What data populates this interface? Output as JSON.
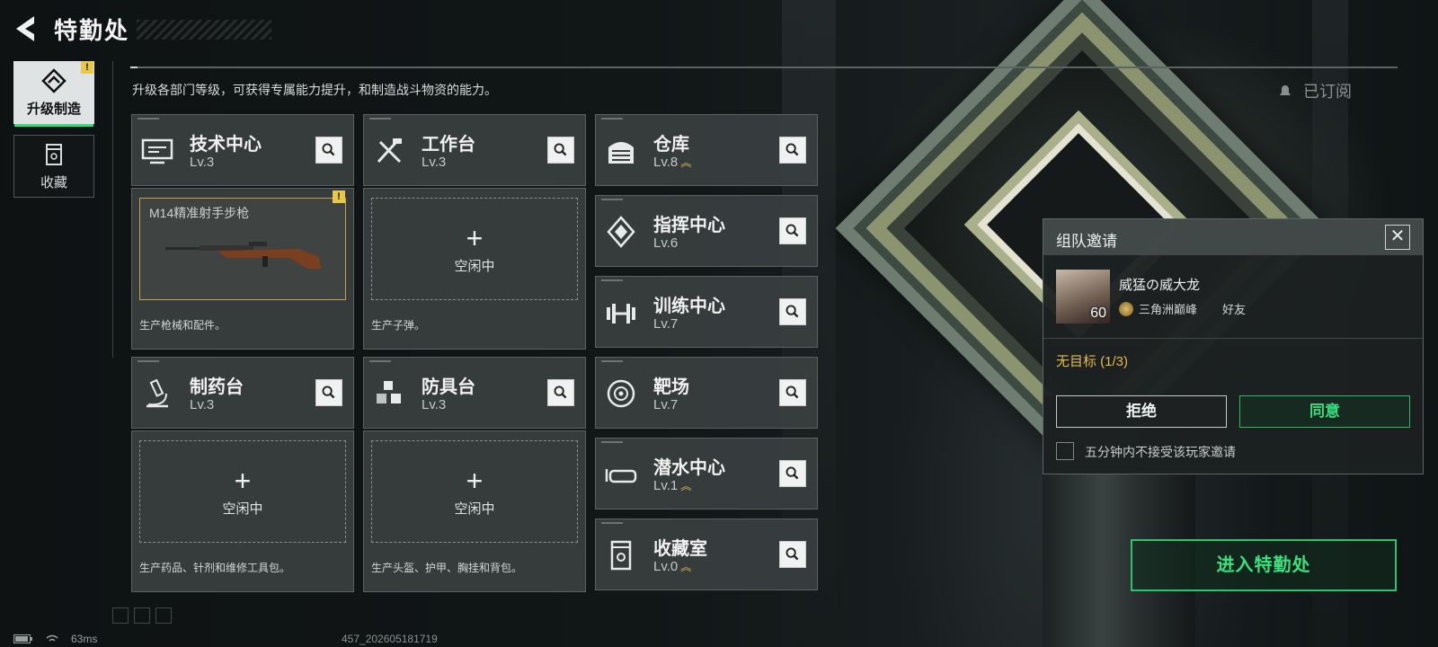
{
  "header": {
    "title": "特勤处",
    "subtitle": "升级各部门等级，可获得专属能力提升，和制造战斗物资的能力。"
  },
  "sidebar": {
    "tabs": [
      {
        "label": "升级制造",
        "icon": "upgrade-icon",
        "active": true,
        "alert": "!"
      },
      {
        "label": "收藏",
        "icon": "collection-icon",
        "active": false
      }
    ]
  },
  "departments": {
    "tech": {
      "name": "技术中心",
      "level": "Lv.3",
      "icon": "monitor-icon"
    },
    "workbench": {
      "name": "工作台",
      "level": "Lv.3",
      "icon": "tools-icon"
    },
    "warehouse": {
      "name": "仓库",
      "level": "Lv.8",
      "icon": "shutter-icon"
    },
    "command": {
      "name": "指挥中心",
      "level": "Lv.6",
      "icon": "command-icon"
    },
    "training": {
      "name": "训练中心",
      "level": "Lv.7",
      "icon": "dumbbell-icon"
    },
    "pharmacy": {
      "name": "制药台",
      "level": "Lv.3",
      "icon": "microscope-icon"
    },
    "armor": {
      "name": "防具台",
      "level": "Lv.3",
      "icon": "cubes-icon"
    },
    "range": {
      "name": "靶场",
      "level": "Lv.7",
      "icon": "target-icon"
    },
    "diving": {
      "name": "潜水中心",
      "level": "Lv.1",
      "icon": "goggles-icon"
    },
    "collection": {
      "name": "收藏室",
      "level": "Lv.0",
      "icon": "cabinet-icon"
    }
  },
  "production": {
    "tech": {
      "item": "M14精准射手步枪",
      "desc": "生产枪械和配件。",
      "alert": "!"
    },
    "workbench": {
      "status": "空闲中",
      "desc": "生产子弹。"
    },
    "pharmacy": {
      "status": "空闲中",
      "desc": "生产药品、针剂和维修工具包。"
    },
    "armor": {
      "status": "空闲中",
      "desc": "生产头盔、护甲、胸挂和背包。"
    }
  },
  "invite": {
    "title": "组队邀请",
    "player_name": "威猛の威大龙",
    "player_level": "60",
    "rank": "三角洲巅峰",
    "relation": "好友",
    "target": "无目标 (1/3)",
    "reject": "拒绝",
    "accept": "同意",
    "mute_label": "五分钟内不接受该玩家邀请"
  },
  "subscribed_label": "已订阅",
  "enter_button": "进入特勤处",
  "status_bar": {
    "ping": "63ms",
    "build": "457_202605181719"
  },
  "colors": {
    "accent": "#2ee07a",
    "warning": "#e7c84a",
    "gold": "#e3b94e"
  }
}
